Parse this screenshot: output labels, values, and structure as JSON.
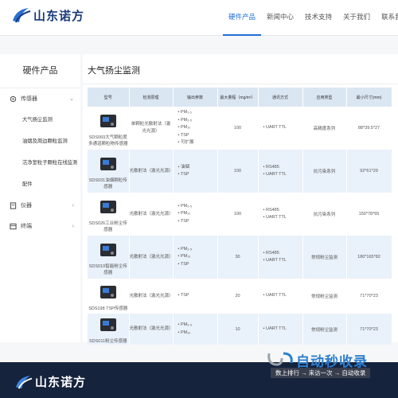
{
  "header": {
    "brand": "山东诺方",
    "nav": [
      "硬件产品",
      "新闻中心",
      "技术支持",
      "关于我们",
      "联系我们"
    ]
  },
  "sidebar": {
    "title": "硬件产品",
    "cat_sensor": "传感器",
    "sub_items": [
      "大气扬尘监测",
      "油烟及周边颗粒监测",
      "洁净室粒子颗粒在线监测",
      "配件"
    ],
    "cat_instrument": "仪器",
    "cat_terminal": "终端"
  },
  "content": {
    "title": "大气扬尘监测",
    "columns": [
      "型号",
      "检测原理",
      "输出参数",
      "最大量程（mg/m³）",
      "通讯方式",
      "应用类型",
      "最小尺寸(mm)"
    ],
    "rows": [
      {
        "model": "SDS069大气颗粒度多通道颗粒物传感器",
        "principle": "单颗粒光散射法（激光光源）",
        "outputs": [
          "PM₁.₀",
          "PM₂.₅",
          "PM₁₀",
          "TSP",
          "可扩展"
        ],
        "range": "100",
        "comm": [
          "UART TTL"
        ],
        "app": "高精度系列",
        "size": "88*39.5*27"
      },
      {
        "model": "SDS031油烟颗粒传感器",
        "principle": "光散射法（激光光源）",
        "outputs": [
          "油烟",
          "TSP"
        ],
        "range": "100",
        "comm": [
          "RS485",
          "UART TTL"
        ],
        "app": "抗污染系列",
        "size": "92*61*29"
      },
      {
        "model": "SDS026工业粉尘传感器",
        "principle": "光散射法（激光光源）",
        "outputs": [
          "PM₂.₅",
          "PM₁₀",
          "TSP"
        ],
        "range": "100",
        "comm": [
          "RS485",
          "UART TTL"
        ],
        "app": "抗污染系列",
        "size": "150*78*65"
      },
      {
        "model": "SDS019智能粉尘传感器",
        "principle": "光散射法（激光光源）",
        "outputs": [
          "PM₂.₅",
          "PM₁₀",
          "TSP"
        ],
        "range": "30",
        "comm": [
          "RS485",
          "UART TTL"
        ],
        "app": "常规粉尘监测",
        "size": "180*165*82"
      },
      {
        "model": "SDS198 TSP传感器",
        "principle": "光散射法（激光光源）",
        "outputs": [
          "TSP"
        ],
        "range": "20",
        "comm": [
          "UART TTL"
        ],
        "app": "常规粉尘监测",
        "size": "71*70*23"
      },
      {
        "model": "SDS011粉尘传感器",
        "principle": "光散射法（激光光源）",
        "outputs": [
          "PM₂.₅",
          "PM₁₀"
        ],
        "range": "10",
        "comm": [
          "UART TTL"
        ],
        "app": "常规粉尘监测",
        "size": "71*70*23"
      }
    ]
  },
  "footer": {
    "brand": "山东诺方"
  },
  "watermark": {
    "big": "自动秒收录",
    "small": "数上排行 → 来访一次 → 自动收录"
  },
  "colors": {
    "accent": "#1e6fd9",
    "brand": "#1a3a7a",
    "footer_bg": "#16233d",
    "table_head": "#dbe6f3",
    "row_alt": "#e9f1fa"
  }
}
